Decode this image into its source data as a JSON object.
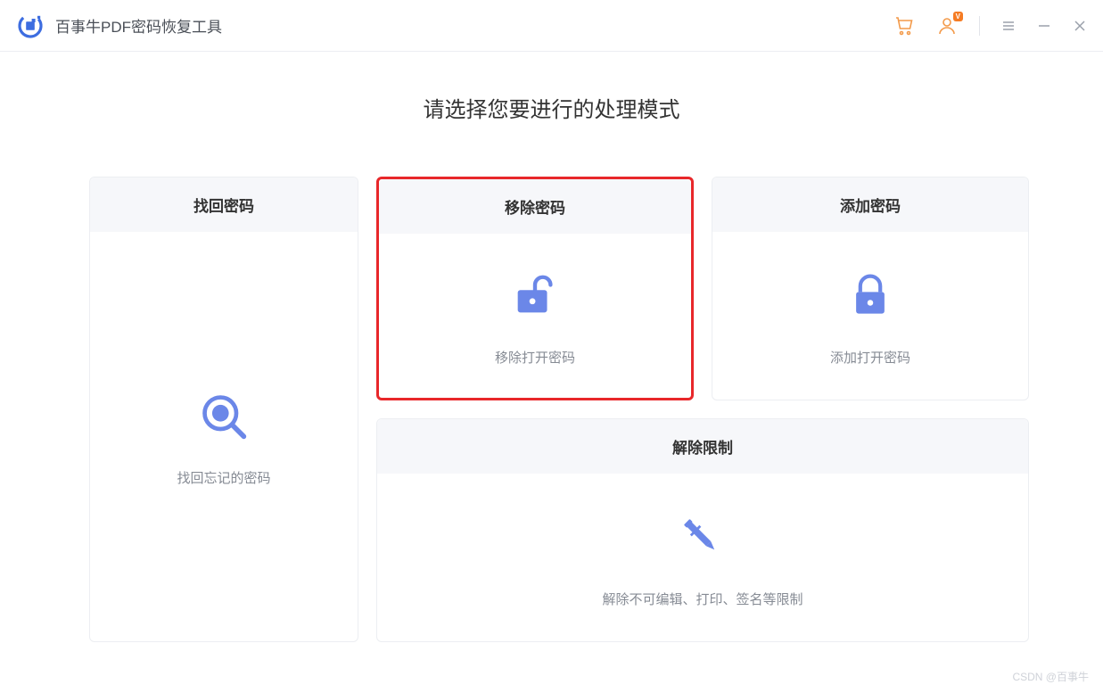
{
  "titlebar": {
    "app_name": "百事牛PDF密码恢复工具"
  },
  "main": {
    "heading": "请选择您要进行的处理模式",
    "cards": {
      "recover": {
        "title": "找回密码",
        "desc": "找回忘记的密码"
      },
      "remove": {
        "title": "移除密码",
        "desc": "移除打开密码"
      },
      "add": {
        "title": "添加密码",
        "desc": "添加打开密码"
      },
      "restrict": {
        "title": "解除限制",
        "desc": "解除不可编辑、打印、签名等限制"
      }
    }
  },
  "watermark": "CSDN @百事牛",
  "colors": {
    "accent_blue": "#6b87e8",
    "highlight_red": "#e8272a",
    "orange": "#f39a4a"
  },
  "icons": {
    "logo": "logo-icon",
    "cart": "cart-icon",
    "user_vip": "user-vip-icon",
    "menu": "menu-icon",
    "minimize": "minimize-icon",
    "close": "close-icon",
    "search": "search-icon",
    "unlock": "unlock-icon",
    "lock": "lock-icon",
    "pencil": "pencil-icon"
  }
}
